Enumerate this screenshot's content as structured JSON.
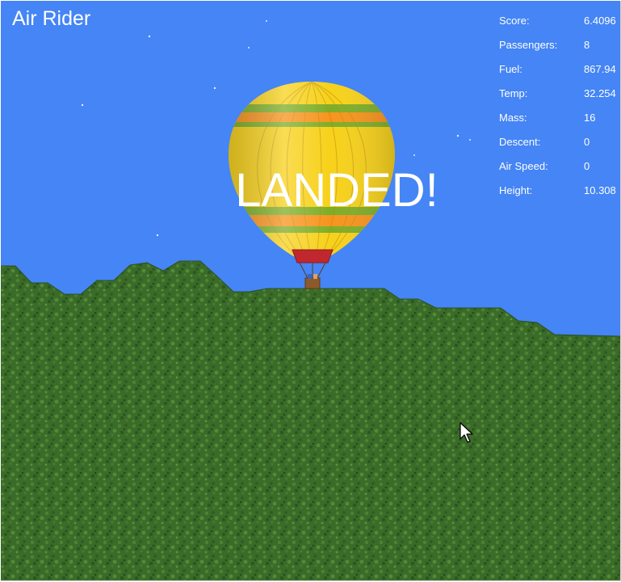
{
  "game": {
    "title": "Air Rider",
    "status_message": "LANDED!",
    "stats": [
      {
        "label": "Score:",
        "value": "6.4096"
      },
      {
        "label": "Passengers:",
        "value": "8"
      },
      {
        "label": "Fuel:",
        "value": "867.94"
      },
      {
        "label": "Temp:",
        "value": "32.254"
      },
      {
        "label": "Mass:",
        "value": "16"
      },
      {
        "label": "Descent:",
        "value": "0"
      },
      {
        "label": "Air Speed:",
        "value": "0"
      },
      {
        "label": "Height:",
        "value": "10.308"
      }
    ]
  },
  "colors": {
    "sky": "#4585f5",
    "grass": "#3d6e2b",
    "balloon_yellow": "#f7d11a",
    "balloon_orange": "#f7941d",
    "balloon_green": "#7dae27",
    "balloon_skirt": "#c0282d"
  }
}
